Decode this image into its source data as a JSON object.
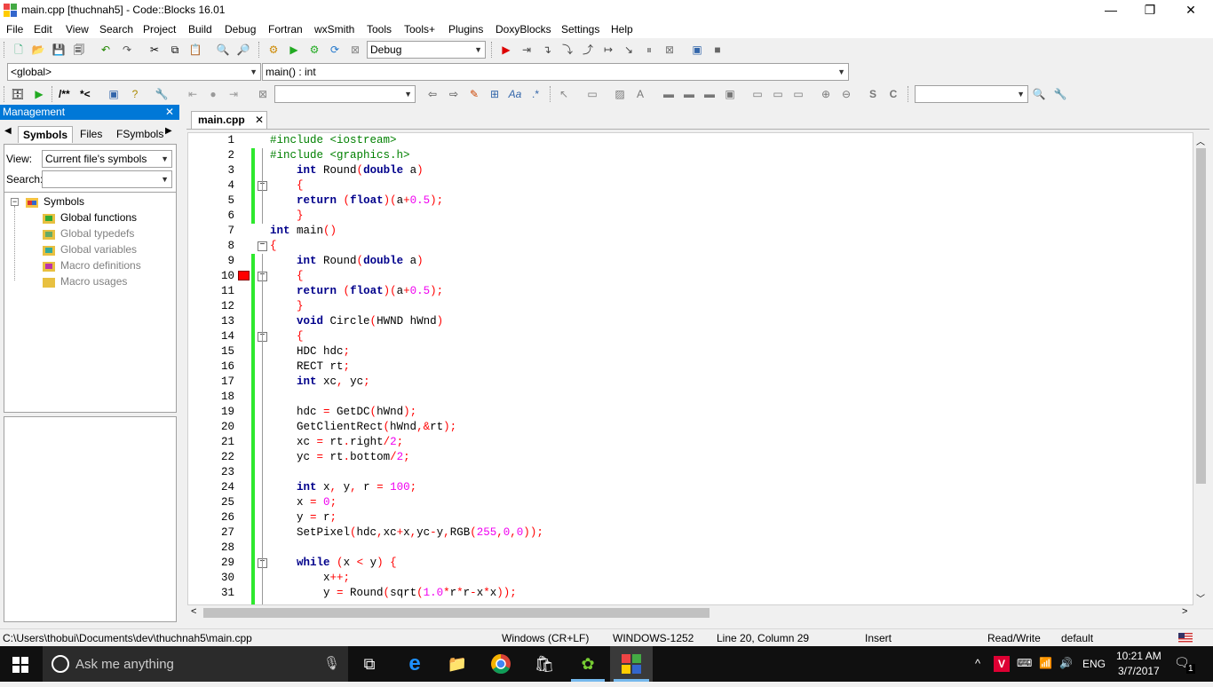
{
  "window": {
    "title": "main.cpp [thuchnah5] - Code::Blocks 16.01",
    "controls": {
      "minimize": "—",
      "maximize": "❐",
      "close": "✕"
    }
  },
  "menubar": [
    "File",
    "Edit",
    "View",
    "Search",
    "Project",
    "Build",
    "Debug",
    "Fortran",
    "wxSmith",
    "Tools",
    "Tools+",
    "Plugins",
    "DoxyBlocks",
    "Settings",
    "Help"
  ],
  "toolbar": {
    "build_target": "Debug",
    "scope_combo": "<global>",
    "function_combo": "main() : int",
    "doxy_comment_label": "/**",
    "doxy_inline_label": "*<"
  },
  "management": {
    "title": "Management",
    "tabs": [
      "Symbols",
      "Files",
      "FSymbols"
    ],
    "active_tab": "Symbols",
    "view_label": "View:",
    "view_value": "Current file's symbols",
    "search_label": "Search:",
    "search_value": "",
    "tree": {
      "root": "Symbols",
      "children": [
        "Global functions",
        "Global typedefs",
        "Global variables",
        "Macro definitions",
        "Macro usages"
      ]
    }
  },
  "editor": {
    "tab_label": "main.cpp",
    "breakpoint_line": 10,
    "lines": [
      {
        "n": "1",
        "text": "#include <iostream>",
        "kind": "pre"
      },
      {
        "n": "2",
        "text": "#include <graphics.h>",
        "kind": "pre"
      },
      {
        "n": "3",
        "text": "    int Round(double a)",
        "kind": "code"
      },
      {
        "n": "4",
        "text": "    {",
        "kind": "brace"
      },
      {
        "n": "5",
        "text": "    return (float)(a+0.5);",
        "kind": "code"
      },
      {
        "n": "6",
        "text": "    }",
        "kind": "brace"
      },
      {
        "n": "7",
        "text": "int main()",
        "kind": "code"
      },
      {
        "n": "8",
        "text": "{",
        "kind": "brace"
      },
      {
        "n": "9",
        "text": "    int Round(double a)",
        "kind": "code"
      },
      {
        "n": "10",
        "text": "    {",
        "kind": "brace"
      },
      {
        "n": "11",
        "text": "    return (float)(a+0.5);",
        "kind": "code"
      },
      {
        "n": "12",
        "text": "    }",
        "kind": "brace"
      },
      {
        "n": "13",
        "text": "    void Circle(HWND hWnd)",
        "kind": "code"
      },
      {
        "n": "14",
        "text": "    {",
        "kind": "brace"
      },
      {
        "n": "15",
        "text": "    HDC hdc;",
        "kind": "code"
      },
      {
        "n": "16",
        "text": "    RECT rt;",
        "kind": "code"
      },
      {
        "n": "17",
        "text": "    int xc, yc;",
        "kind": "code"
      },
      {
        "n": "18",
        "text": "",
        "kind": "code"
      },
      {
        "n": "19",
        "text": "    hdc = GetDC(hWnd);",
        "kind": "code"
      },
      {
        "n": "20",
        "text": "    GetClientRect(hWnd,&rt);",
        "kind": "code"
      },
      {
        "n": "21",
        "text": "    xc = rt.right/2;",
        "kind": "code"
      },
      {
        "n": "22",
        "text": "    yc = rt.bottom/2;",
        "kind": "code"
      },
      {
        "n": "23",
        "text": "",
        "kind": "code"
      },
      {
        "n": "24",
        "text": "    int x, y, r = 100;",
        "kind": "code"
      },
      {
        "n": "25",
        "text": "    x = 0;",
        "kind": "code"
      },
      {
        "n": "26",
        "text": "    y = r;",
        "kind": "code"
      },
      {
        "n": "27",
        "text": "    SetPixel(hdc,xc+x,yc-y,RGB(255,0,0));",
        "kind": "code"
      },
      {
        "n": "28",
        "text": "",
        "kind": "code"
      },
      {
        "n": "29",
        "text": "    while (x < y) {",
        "kind": "code"
      },
      {
        "n": "30",
        "text": "        x++;",
        "kind": "code"
      },
      {
        "n": "31",
        "text": "        y = Round(sqrt(1.0*r*r-x*x));",
        "kind": "code"
      }
    ]
  },
  "statusbar": {
    "path": "C:\\Users\\thobui\\Documents\\dev\\thuchnah5\\main.cpp",
    "line_endings": "Windows (CR+LF)",
    "encoding": "WINDOWS-1252",
    "position": "Line 20, Column 29",
    "mode": "Insert",
    "access": "Read/Write",
    "profile": "default"
  },
  "taskbar": {
    "search_placeholder": "Ask me anything",
    "language": "ENG",
    "time": "10:21 AM",
    "date": "3/7/2017",
    "notification_count": "1"
  },
  "colors": {
    "accent": "#0078d7",
    "keyword": "#00008b",
    "preprocessor": "#008000",
    "number": "#f000f0",
    "operator": "#ff0000",
    "breakpoint": "#ff0000",
    "change_bar": "#2ee82e"
  }
}
